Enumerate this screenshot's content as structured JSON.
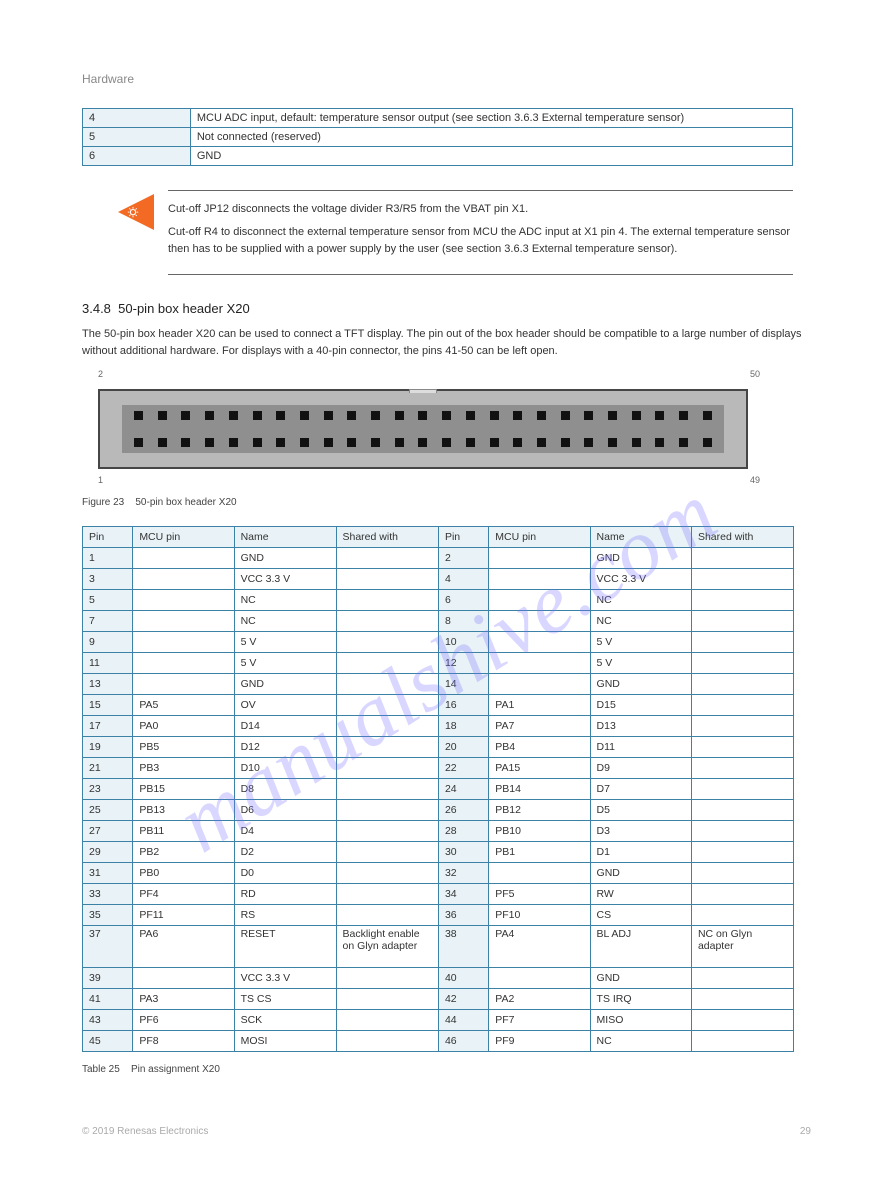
{
  "page_header": "Hardware",
  "small_table": [
    {
      "h": "4",
      "v": "MCU ADC input, default: temperature sensor output (see section 3.6.3 External temperature sensor)"
    },
    {
      "h": "5",
      "v": "Not connected (reserved)"
    },
    {
      "h": "6",
      "v": "GND"
    }
  ],
  "hint": {
    "paragraphs": [
      "Cut-off JP12 disconnects the voltage divider R3/R5 from the VBAT pin X1.",
      "Cut-off R4 to disconnect the external temperature sensor from MCU the ADC input at X1 pin 4. The external temperature sensor then has to be supplied with a power supply by the user (see section 3.6.3 External temperature sensor)."
    ]
  },
  "section": {
    "num": "3.4.8",
    "title": "50-pin box header X20",
    "body": "The 50-pin box header X20 can be used to connect a TFT display. The pin out of the box header should be compatible to a large number of displays without additional hardware. For displays with a 40-pin connector, the pins 41-50 can be left open."
  },
  "figure": {
    "caption": "Figure 23",
    "title": "50-pin box header X20",
    "pin_nums": {
      "p1": "1",
      "p2": "2",
      "p49": "49",
      "p50": "50"
    }
  },
  "pins_table": {
    "headers": [
      "Pin",
      "MCU pin",
      "Name",
      "Shared with",
      "Pin",
      "MCU pin",
      "Name",
      "Shared with"
    ],
    "rows": [
      {
        "c": [
          "1",
          "",
          "GND",
          "",
          "2",
          "",
          "GND",
          ""
        ]
      },
      {
        "c": [
          "3",
          "",
          "VCC 3.3 V",
          "",
          "4",
          "",
          "VCC 3.3 V",
          ""
        ]
      },
      {
        "c": [
          "5",
          "",
          "NC",
          "",
          "6",
          "",
          "NC",
          ""
        ]
      },
      {
        "c": [
          "7",
          "",
          "NC",
          "",
          "8",
          "",
          "NC",
          ""
        ]
      },
      {
        "c": [
          "9",
          "",
          "5 V",
          "",
          "10",
          "",
          "5 V",
          ""
        ]
      },
      {
        "c": [
          "11",
          "",
          "5 V",
          "",
          "12",
          "",
          "5 V",
          ""
        ]
      },
      {
        "c": [
          "13",
          "",
          "GND",
          "",
          "14",
          "",
          "GND",
          ""
        ]
      },
      {
        "c": [
          "15",
          "PA5",
          "OV",
          "",
          "16",
          "PA1",
          "D15",
          ""
        ]
      },
      {
        "c": [
          "17",
          "PA0",
          "D14",
          "",
          "18",
          "PA7",
          "D13",
          ""
        ]
      },
      {
        "c": [
          "19",
          "PB5",
          "D12",
          "",
          "20",
          "PB4",
          "D11",
          ""
        ]
      },
      {
        "c": [
          "21",
          "PB3",
          "D10",
          "",
          "22",
          "PA15",
          "D9",
          ""
        ]
      },
      {
        "c": [
          "23",
          "PB15",
          "D8",
          "",
          "24",
          "PB14",
          "D7",
          ""
        ]
      },
      {
        "c": [
          "25",
          "PB13",
          "D6",
          "",
          "26",
          "PB12",
          "D5",
          ""
        ]
      },
      {
        "c": [
          "27",
          "PB11",
          "D4",
          "",
          "28",
          "PB10",
          "D3",
          ""
        ]
      },
      {
        "c": [
          "29",
          "PB2",
          "D2",
          "",
          "30",
          "PB1",
          "D1",
          ""
        ]
      },
      {
        "c": [
          "31",
          "PB0",
          "D0",
          "",
          "32",
          "",
          "GND",
          ""
        ]
      },
      {
        "c": [
          "33",
          "PF4",
          "RD",
          "",
          "34",
          "PF5",
          "RW",
          ""
        ]
      },
      {
        "c": [
          "35",
          "PF11",
          "RS",
          "",
          "36",
          "PF10",
          "CS",
          ""
        ]
      },
      {
        "c": [
          "37",
          "PA6",
          "RESET",
          "Backlight enable on Glyn adapter",
          "38",
          "PA4",
          "BL ADJ",
          "NC on Glyn adapter"
        ]
      },
      {
        "c": [
          "39",
          "",
          "VCC 3.3 V",
          "",
          "40",
          "",
          "GND",
          ""
        ]
      },
      {
        "c": [
          "41",
          "PA3",
          "TS CS",
          "",
          "42",
          "PA2",
          "TS IRQ",
          ""
        ]
      },
      {
        "c": [
          "43",
          "PF6",
          "SCK",
          "",
          "44",
          "PF7",
          "MISO",
          ""
        ]
      },
      {
        "c": [
          "45",
          "PF8",
          "MOSI",
          "",
          "46",
          "PF9",
          "NC",
          ""
        ]
      }
    ],
    "caption": "Table 25",
    "cap_title": "Pin assignment X20"
  },
  "watermark": "manualshive.com",
  "footer": {
    "left": "© 2019 Renesas Electronics",
    "right": "29"
  }
}
